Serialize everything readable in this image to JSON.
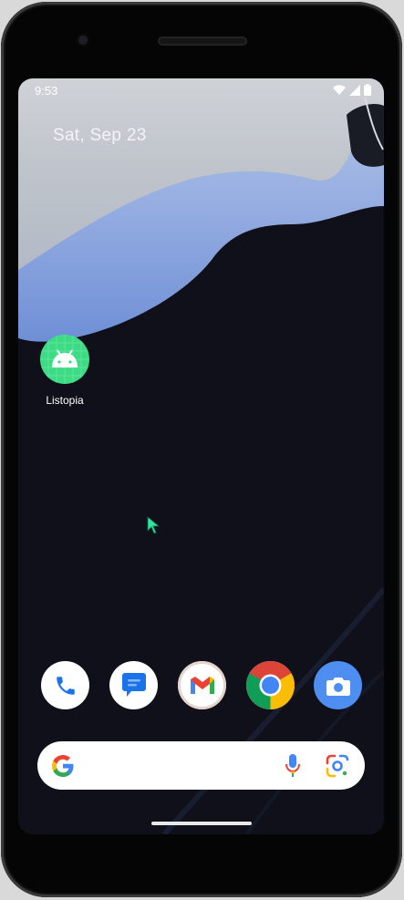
{
  "status_bar": {
    "time": "9:53",
    "icons": [
      "wifi-icon",
      "cellular-signal-icon",
      "battery-icon"
    ]
  },
  "home": {
    "date": "Sat, Sep 23",
    "apps": [
      {
        "label": "Listopia",
        "icon": "android-app-icon",
        "color": "#3ddc84"
      }
    ]
  },
  "dock": {
    "apps": [
      "phone-icon",
      "messages-icon",
      "gmail-icon",
      "chrome-icon",
      "camera-icon"
    ]
  },
  "search_bar": {
    "icons": [
      "google-g-icon",
      "microphone-icon",
      "google-lens-icon"
    ]
  },
  "colors": {
    "screen_bg": "#0f1019",
    "wallpaper_blue": "#7f9ee0",
    "android_green": "#3ddc84",
    "cursor": "#2ee6a0"
  }
}
